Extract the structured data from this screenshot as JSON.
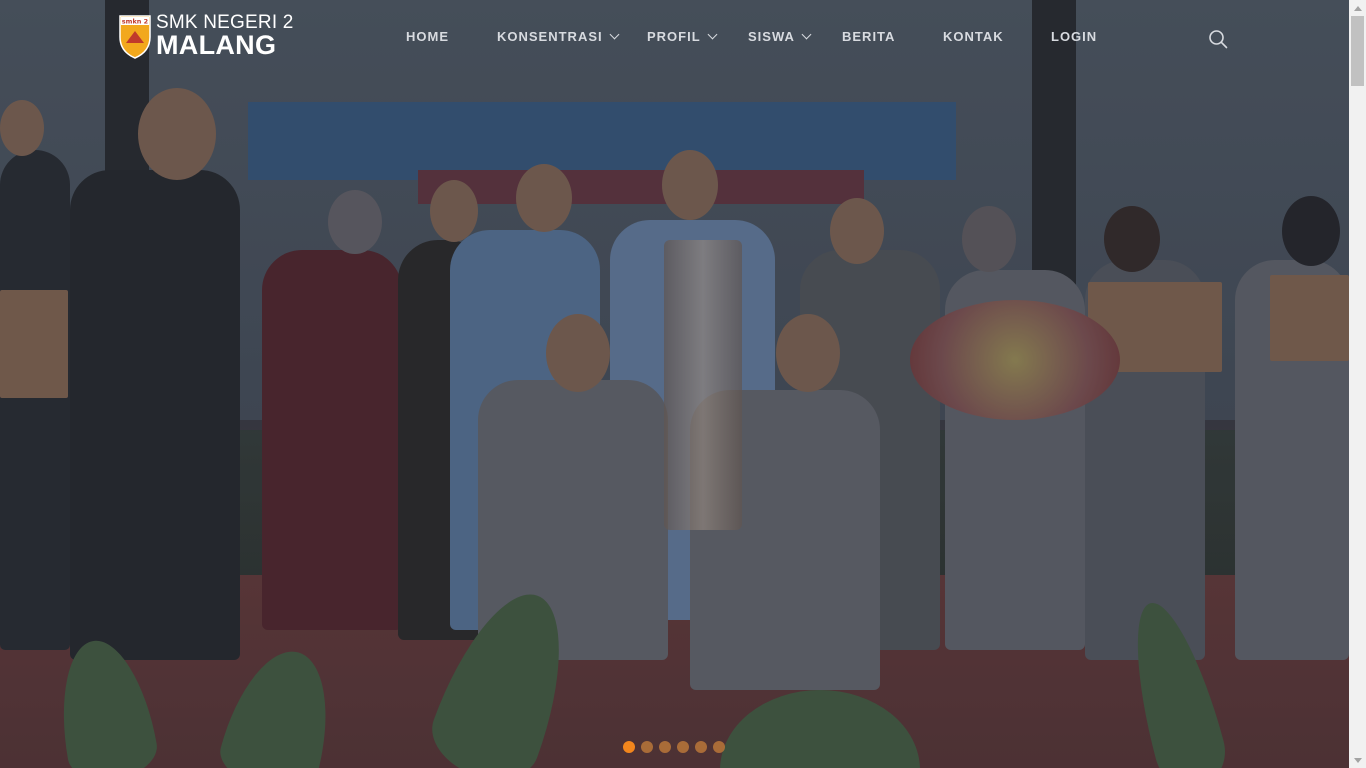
{
  "logo": {
    "line1": "SMK NEGERI 2",
    "line2": "MALANG",
    "badge_text": "smkn 2"
  },
  "nav": {
    "items": [
      {
        "label": "HOME",
        "dropdown": false
      },
      {
        "label": "KONSENTRASI",
        "dropdown": true
      },
      {
        "label": "PROFIL",
        "dropdown": true
      },
      {
        "label": "SISWA",
        "dropdown": true
      },
      {
        "label": "BERITA",
        "dropdown": false
      },
      {
        "label": "KONTAK",
        "dropdown": false
      },
      {
        "label": "LOGIN",
        "dropdown": false
      }
    ],
    "search_icon": "search-icon"
  },
  "hero": {
    "slide_count": 6,
    "active_slide": 1
  },
  "colors": {
    "accent": "#f2861d",
    "nav_text": "#d8dbe0",
    "logo_text": "#ffffff"
  }
}
